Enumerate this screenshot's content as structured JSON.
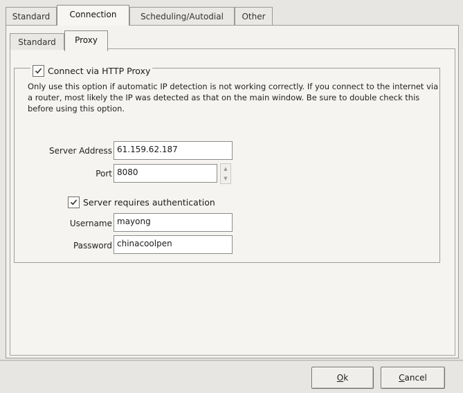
{
  "top_tabs": [
    {
      "label": "Standard",
      "active": false
    },
    {
      "label": "Connection",
      "active": true
    },
    {
      "label": "Scheduling/Autodial",
      "active": false
    },
    {
      "label": "Other",
      "active": false
    }
  ],
  "inner_tabs": [
    {
      "label": "Standard",
      "active": false
    },
    {
      "label": "Proxy",
      "active": true
    }
  ],
  "proxy": {
    "connect_via_label": "Connect via HTTP Proxy",
    "connect_via_checked": true,
    "description": "Only use this option if automatic IP detection is not working correctly.  If you connect to the internet via a router, most likely the IP was detected as that on the main window.  Be sure to double check this before using this option.",
    "server_address_label": "Server Address",
    "server_address_value": "61.159.62.187",
    "port_label": "Port",
    "port_value": "8080",
    "auth_label": "Server requires authentication",
    "auth_checked": true,
    "username_label": "Username",
    "username_value": "mayong",
    "password_label": "Password",
    "password_value": "chinacoolpen"
  },
  "buttons": {
    "ok_accel": "O",
    "ok_rest": "k",
    "cancel_accel": "C",
    "cancel_rest": "ancel"
  },
  "icons": {
    "checkmark": "check-icon",
    "spin_up": "spin-up-icon",
    "spin_down": "spin-down-icon"
  }
}
